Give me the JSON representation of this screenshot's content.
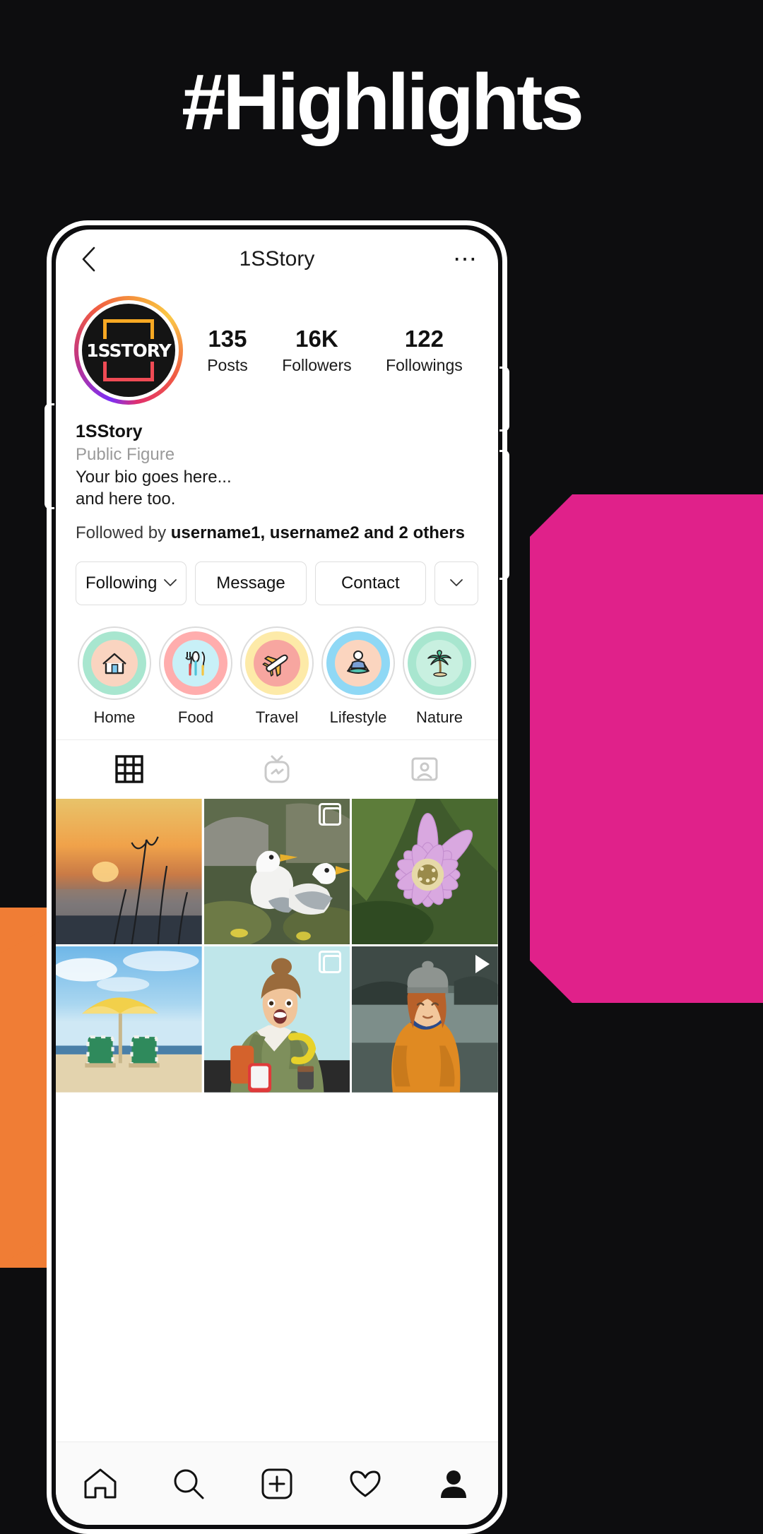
{
  "headline": "#Highlights",
  "app": {
    "title": "1SStory",
    "back_icon": "chevron-left-icon",
    "more_icon": "more-options-icon"
  },
  "profile": {
    "avatar_logo": "1SSTORY",
    "stats": [
      {
        "number": "135",
        "label": "Posts"
      },
      {
        "number": "16K",
        "label": "Followers"
      },
      {
        "number": "122",
        "label": "Followings"
      }
    ],
    "name": "1SStory",
    "category": "Public Figure",
    "bio_line1": "Your bio goes here...",
    "bio_line2": "and here too.",
    "followed_by_prefix": "Followed by ",
    "followed_by_names": "username1, username2 and 2 others"
  },
  "actions": {
    "following": "Following",
    "following_caret": "⌄",
    "message": "Message",
    "contact": "Contact",
    "expand_caret": "⌄"
  },
  "highlights": [
    {
      "label": "Home",
      "icon": "house-icon",
      "glyph": "🏠",
      "ring": "#a8e6cf",
      "inner": "#fad4c0"
    },
    {
      "label": "Food",
      "icon": "cutlery-icon",
      "glyph": "🍴",
      "ring": "#ffadad",
      "inner": "#c8f0f7"
    },
    {
      "label": "Travel",
      "icon": "airplane-icon",
      "glyph": "✈",
      "ring": "#fdeaa8",
      "inner": "#f7a6a0"
    },
    {
      "label": "Lifestyle",
      "icon": "meditation-icon",
      "glyph": "🧘",
      "ring": "#8fd8f5",
      "inner": "#fbd5bf"
    },
    {
      "label": "Nature",
      "icon": "palm-tree-icon",
      "glyph": "🌴",
      "ring": "#a8e6cf",
      "inner": "#c8f0e0"
    }
  ],
  "tabs": [
    {
      "name": "grid-tab",
      "icon": "grid-icon",
      "active": true
    },
    {
      "name": "igtv-tab",
      "icon": "igtv-icon",
      "active": false
    },
    {
      "name": "tagged-tab",
      "icon": "tagged-icon",
      "active": false
    }
  ],
  "grid_posts": [
    {
      "name": "sunset-reeds-photo",
      "badge": "none"
    },
    {
      "name": "seagulls-photo",
      "badge": "multi"
    },
    {
      "name": "purple-flower-photo",
      "badge": "none"
    },
    {
      "name": "beach-umbrella-photo",
      "badge": "none"
    },
    {
      "name": "woman-phone-photo",
      "badge": "multi"
    },
    {
      "name": "woman-lake-photo",
      "badge": "play"
    }
  ],
  "bottom_nav": [
    {
      "name": "home-nav",
      "icon": "home-icon"
    },
    {
      "name": "search-nav",
      "icon": "search-icon"
    },
    {
      "name": "add-nav",
      "icon": "plus-box-icon"
    },
    {
      "name": "activity-nav",
      "icon": "heart-icon"
    },
    {
      "name": "profile-nav",
      "icon": "person-icon"
    }
  ],
  "colors": {
    "background": "#0d0d0f",
    "orange": "#f07d35",
    "pink": "#e0218a",
    "accent_white": "#ffffff"
  }
}
